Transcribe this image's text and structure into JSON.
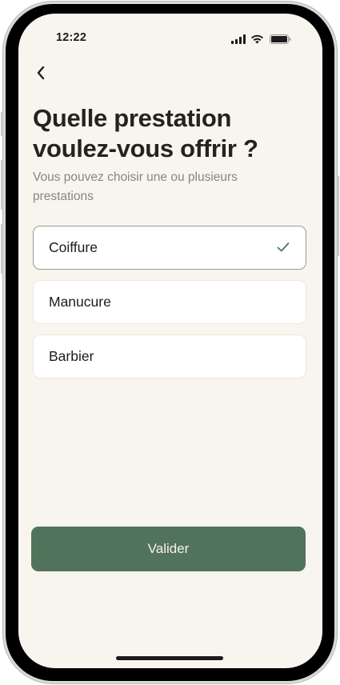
{
  "status_bar": {
    "time": "12:22",
    "icons": [
      "cellular-signal-icon",
      "wifi-icon",
      "battery-icon"
    ]
  },
  "nav": {
    "back_icon": "chevron-left-icon"
  },
  "header": {
    "title": "Quelle prestation voulez-vous offrir ?",
    "subtitle": "Vous pouvez choisir une ou plusieurs prestations"
  },
  "options": [
    {
      "label": "Coiffure",
      "selected": true
    },
    {
      "label": "Manucure",
      "selected": false
    },
    {
      "label": "Barbier",
      "selected": false
    }
  ],
  "actions": {
    "submit_label": "Valider"
  },
  "colors": {
    "background": "#f8f5ef",
    "accent": "#52735b",
    "check": "#52735b",
    "title": "#26221d",
    "subtitle": "#8a857d"
  }
}
